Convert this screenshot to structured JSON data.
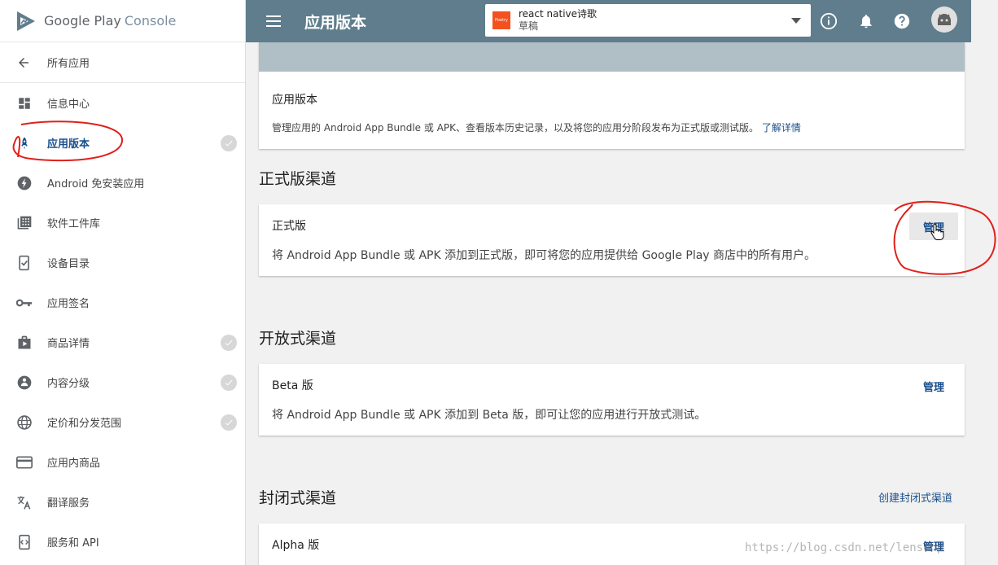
{
  "brand": {
    "name": "Google Play",
    "product": "Console"
  },
  "sidebar": {
    "back_label": "所有应用",
    "items": [
      {
        "label": "信息中心",
        "icon": "dashboard-icon",
        "active": false,
        "done": false
      },
      {
        "label": "应用版本",
        "icon": "rocket-icon",
        "active": true,
        "done": true
      },
      {
        "label": "Android 免安装应用",
        "icon": "bolt-icon",
        "active": false,
        "done": false
      },
      {
        "label": "软件工件库",
        "icon": "library-icon",
        "active": false,
        "done": false
      },
      {
        "label": "设备目录",
        "icon": "device-catalog-icon",
        "active": false,
        "done": false
      },
      {
        "label": "应用签名",
        "icon": "key-icon",
        "active": false,
        "done": false
      },
      {
        "label": "商品详情",
        "icon": "store-icon",
        "active": false,
        "done": true
      },
      {
        "label": "内容分级",
        "icon": "rating-icon",
        "active": false,
        "done": true
      },
      {
        "label": "定价和分发范围",
        "icon": "globe-icon",
        "active": false,
        "done": true
      },
      {
        "label": "应用内商品",
        "icon": "card-icon",
        "active": false,
        "done": false
      },
      {
        "label": "翻译服务",
        "icon": "translate-icon",
        "active": false,
        "done": false
      },
      {
        "label": "服务和 API",
        "icon": "api-icon",
        "active": false,
        "done": false
      }
    ]
  },
  "header": {
    "title": "应用版本",
    "app_selector": {
      "app_name": "react native诗歌",
      "state": "草稿",
      "icon_text": "Poetry"
    }
  },
  "intro": {
    "title": "应用版本",
    "description": "管理应用的 Android App Bundle 或 APK、查看版本历史记录，以及将您的应用分阶段发布为正式版或测试版。",
    "learn_more": "了解详情"
  },
  "sections": {
    "production": {
      "title": "正式版渠道",
      "track_name": "正式版",
      "track_desc": "将 Android App Bundle 或 APK 添加到正式版，即可将您的应用提供给 Google Play 商店中的所有用户。",
      "manage": "管理"
    },
    "open": {
      "title": "开放式渠道",
      "track_name": "Beta 版",
      "track_desc": "将 Android App Bundle 或 APK 添加到 Beta 版，即可让您的应用进行开放式测试。",
      "manage": "管理"
    },
    "closed": {
      "title": "封闭式渠道",
      "create_link": "创建封闭式渠道",
      "track_name": "Alpha 版",
      "manage": "管理"
    }
  },
  "watermark": "https://blog.csdn.net/lensenp",
  "colors": {
    "header": "#5f7d8d",
    "accent": "#1a4f8b",
    "annotation": "#e0201b"
  }
}
